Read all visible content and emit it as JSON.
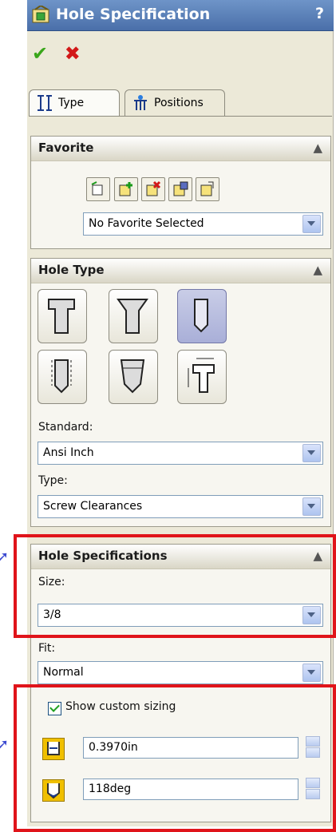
{
  "title": "Hole Specification",
  "help": "?",
  "actions": {
    "ok": "✔",
    "cancel": "✖"
  },
  "tabs": [
    {
      "label": "Type"
    },
    {
      "label": "Positions"
    }
  ],
  "favorite": {
    "title": "Favorite",
    "selected": "No Favorite Selected"
  },
  "hole_type": {
    "title": "Hole Type",
    "standard_label": "Standard:",
    "standard_value": "Ansi Inch",
    "type_label": "Type:",
    "type_value": "Screw Clearances"
  },
  "hole_specs": {
    "title": "Hole Specifications",
    "size_label": "Size:",
    "size_value": "3/8",
    "fit_label": "Fit:",
    "fit_value": "Normal",
    "custom_sizing_label": "Show custom sizing",
    "custom_sizing_checked": true,
    "diameter_value": "0.3970in",
    "angle_value": "118deg"
  },
  "colors": {
    "annotation": "#e0141a",
    "titlebar": "#4a6fa9",
    "arrow": "#3b49d0"
  }
}
